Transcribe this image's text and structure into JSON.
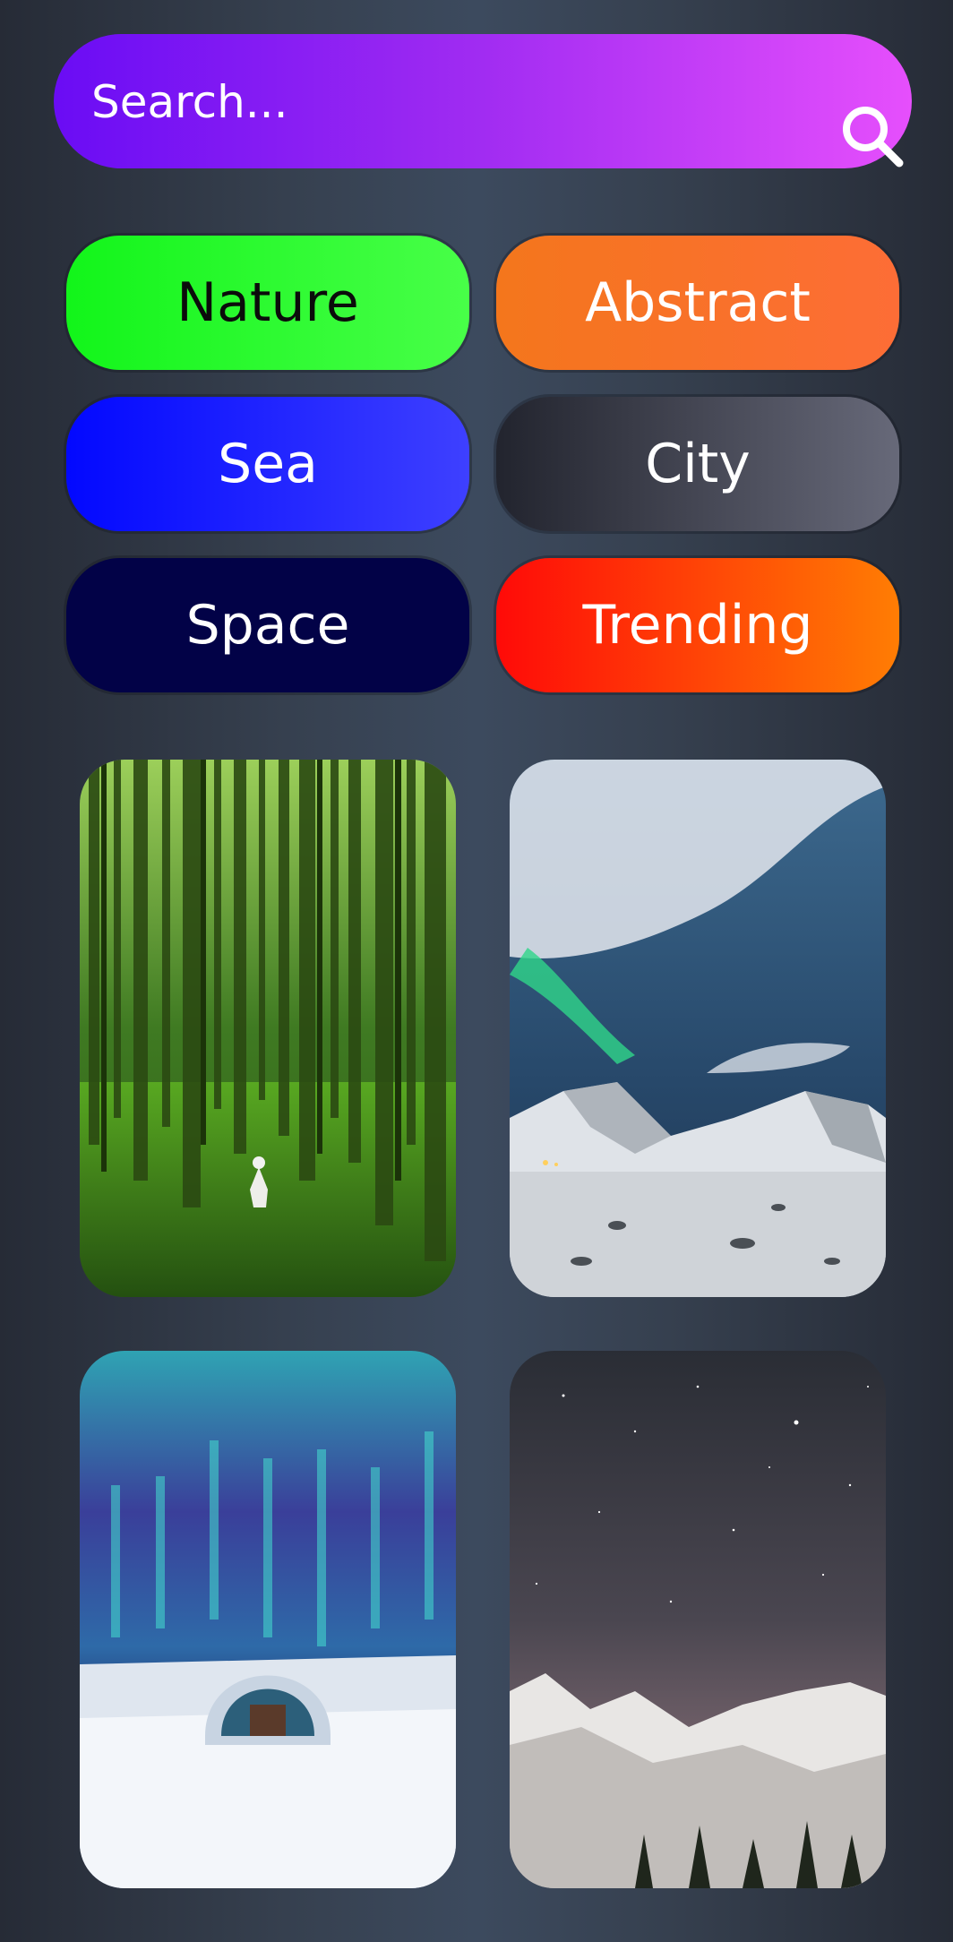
{
  "search": {
    "placeholder": "Search...",
    "icon": "search-icon"
  },
  "categories": [
    {
      "label": "Nature"
    },
    {
      "label": "Abstract"
    },
    {
      "label": "Sea"
    },
    {
      "label": "City"
    },
    {
      "label": "Space"
    },
    {
      "label": "Trending"
    }
  ],
  "wallpapers": [
    {
      "subject": "forest"
    },
    {
      "subject": "aurora-mountain"
    },
    {
      "subject": "ice-igloo-aurora"
    },
    {
      "subject": "starry-mountains"
    }
  ]
}
